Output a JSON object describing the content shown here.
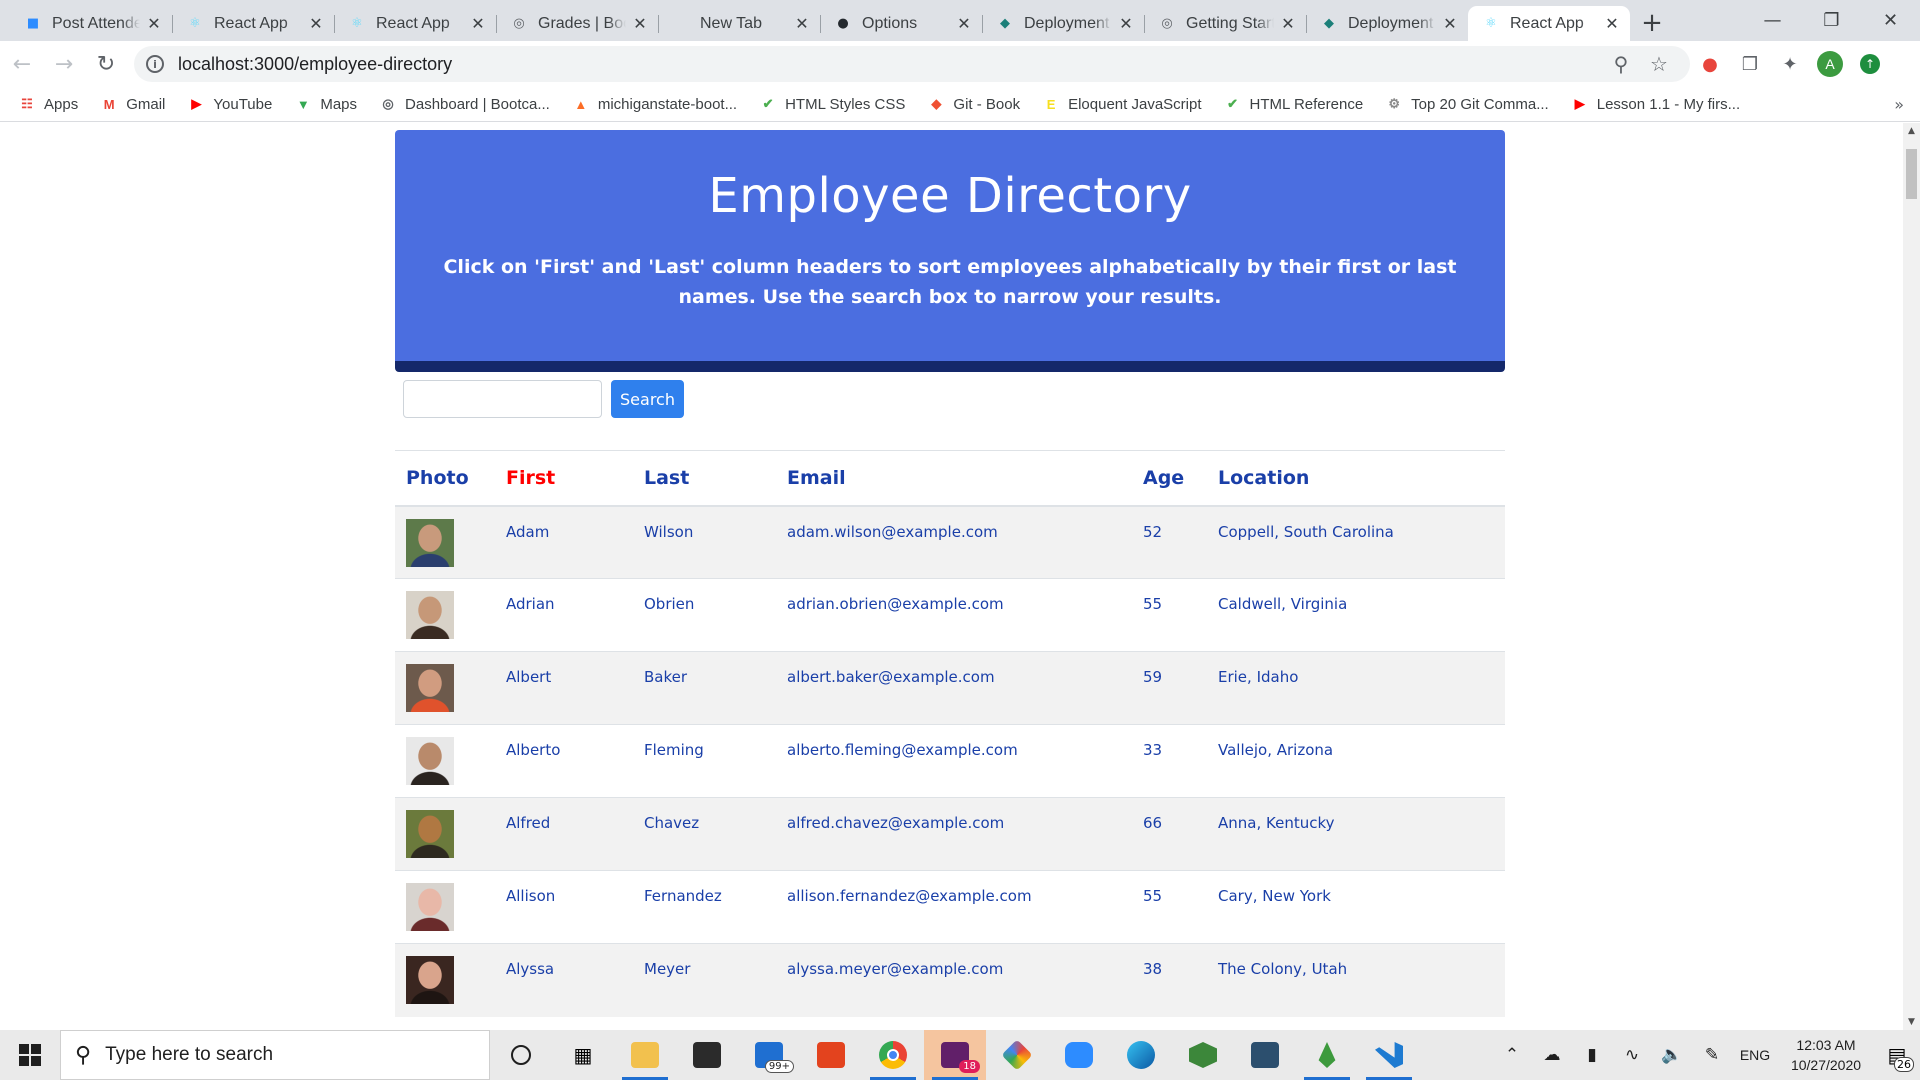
{
  "browser": {
    "tabs": [
      {
        "title": "Post Attendee",
        "icon": "zoom-icon",
        "color": "#2d8cff",
        "active": false
      },
      {
        "title": "React App",
        "icon": "react-icon",
        "color": "#61dafb",
        "active": false
      },
      {
        "title": "React App",
        "icon": "react-icon",
        "color": "#61dafb",
        "active": false
      },
      {
        "title": "Grades | Bootcamp",
        "icon": "globe-icon",
        "color": "#5f6368",
        "active": false
      },
      {
        "title": "New Tab",
        "icon": "",
        "color": "",
        "active": false
      },
      {
        "title": "Options",
        "icon": "github-icon",
        "color": "#24292e",
        "active": false
      },
      {
        "title": "Deployment",
        "icon": "netlify-icon",
        "color": "#1b7f79",
        "active": false
      },
      {
        "title": "Getting Started",
        "icon": "globe-icon",
        "color": "#5f6368",
        "active": false
      },
      {
        "title": "Deployment",
        "icon": "netlify-icon",
        "color": "#1b7f79",
        "active": false
      },
      {
        "title": "React App",
        "icon": "react-icon",
        "color": "#61dafb",
        "active": true
      }
    ],
    "new_tab": "+",
    "url": "localhost:3000/employee-directory",
    "bookmarks": [
      {
        "label": "Apps",
        "icon": "apps-grid-icon",
        "color": "#e8453c"
      },
      {
        "label": "Gmail",
        "icon": "gmail-icon",
        "color": "#ea4335"
      },
      {
        "label": "YouTube",
        "icon": "youtube-icon",
        "color": "#ff0000"
      },
      {
        "label": "Maps",
        "icon": "maps-pin-icon",
        "color": "#34a853"
      },
      {
        "label": "Dashboard | Bootca...",
        "icon": "globe-icon",
        "color": "#5f6368"
      },
      {
        "label": "michiganstate-boot...",
        "icon": "gitlab-icon",
        "color": "#fc6d26"
      },
      {
        "label": "HTML Styles CSS",
        "icon": "w3-icon",
        "color": "#4caf50"
      },
      {
        "label": "Git - Book",
        "icon": "git-icon",
        "color": "#f05133"
      },
      {
        "label": "Eloquent JavaScript",
        "icon": "ejs-icon",
        "color": "#f7df1e"
      },
      {
        "label": "HTML Reference",
        "icon": "w3-icon",
        "color": "#4caf50"
      },
      {
        "label": "Top 20 Git Comma...",
        "icon": "gear-globe-icon",
        "color": "#8a8a8a"
      },
      {
        "label": "Lesson 1.1 - My firs...",
        "icon": "youtube-icon",
        "color": "#ff0000"
      }
    ],
    "profile_initial": "A"
  },
  "page": {
    "title": "Employee Directory",
    "subtitle": "Click on 'First' and 'Last' column headers to sort employees alphabetically by their first or last names. Use the search box to narrow your results.",
    "search": {
      "value": "",
      "button": "Search"
    },
    "columns": [
      "Photo",
      "First",
      "Last",
      "Email",
      "Age",
      "Location"
    ],
    "sorted_column": "First",
    "employees": [
      {
        "first": "Adam",
        "last": "Wilson",
        "email": "adam.wilson@example.com",
        "age": "52",
        "location": "Coppell, South Carolina",
        "avatar_colors": [
          "#5d7a4a",
          "#2b3f6e",
          "#c89a7c"
        ]
      },
      {
        "first": "Adrian",
        "last": "Obrien",
        "email": "adrian.obrien@example.com",
        "age": "55",
        "location": "Caldwell, Virginia",
        "avatar_colors": [
          "#d8d2c8",
          "#3a2b22",
          "#c69878"
        ]
      },
      {
        "first": "Albert",
        "last": "Baker",
        "email": "albert.baker@example.com",
        "age": "59",
        "location": "Erie, Idaho",
        "avatar_colors": [
          "#6d5a4c",
          "#e0522c",
          "#d19c80"
        ]
      },
      {
        "first": "Alberto",
        "last": "Fleming",
        "email": "alberto.fleming@example.com",
        "age": "33",
        "location": "Vallejo, Arizona",
        "avatar_colors": [
          "#e8e8e8",
          "#2a2420",
          "#b98a6b"
        ]
      },
      {
        "first": "Alfred",
        "last": "Chavez",
        "email": "alfred.chavez@example.com",
        "age": "66",
        "location": "Anna, Kentucky",
        "avatar_colors": [
          "#6b7a3c",
          "#2e2a20",
          "#b07842"
        ]
      },
      {
        "first": "Allison",
        "last": "Fernandez",
        "email": "allison.fernandez@example.com",
        "age": "55",
        "location": "Cary, New York",
        "avatar_colors": [
          "#d8d4cf",
          "#6a2b2b",
          "#e8b8a8"
        ]
      },
      {
        "first": "Alyssa",
        "last": "Meyer",
        "email": "alyssa.meyer@example.com",
        "age": "38",
        "location": "The Colony, Utah",
        "avatar_colors": [
          "#3a2620",
          "#1e1512",
          "#d9a48c"
        ]
      }
    ]
  },
  "taskbar": {
    "search_placeholder": "Type here to search",
    "mail_badge": "99+",
    "slack_badge": "18",
    "language": "ENG",
    "time": "12:03 AM",
    "date": "10/27/2020",
    "notifications": "26"
  }
}
